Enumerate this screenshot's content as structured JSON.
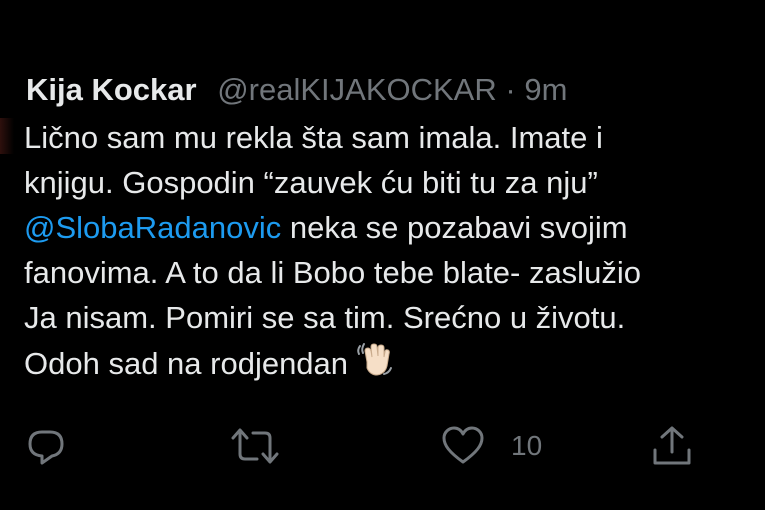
{
  "tweet": {
    "author_name": "Kija Kockar",
    "author_handle": "@realKIJAKOCKAR",
    "separator": "·",
    "timestamp": "9m",
    "lines": {
      "line1": "Lično sam mu rekla šta sam imala. Imate i",
      "line2": "knjigu. Gospodin “zauvek ću biti tu za nju”",
      "line3_mention": "@SlobaRadanovic",
      "line3_rest": " neka se pozabavi svojim",
      "line4": "fanovima. A to da li Bobo tebe blate- zaslužio",
      "line5": "Ja nisam. Pomiri se sa tim. Srećno u životu.",
      "line6": "Odoh sad na rodjendan"
    },
    "emoji": "waving-hand-icon",
    "like_count": "10"
  },
  "colors": {
    "background": "#000000",
    "text": "#e7e9ea",
    "secondary": "#71767b",
    "link": "#1d9bf0"
  }
}
